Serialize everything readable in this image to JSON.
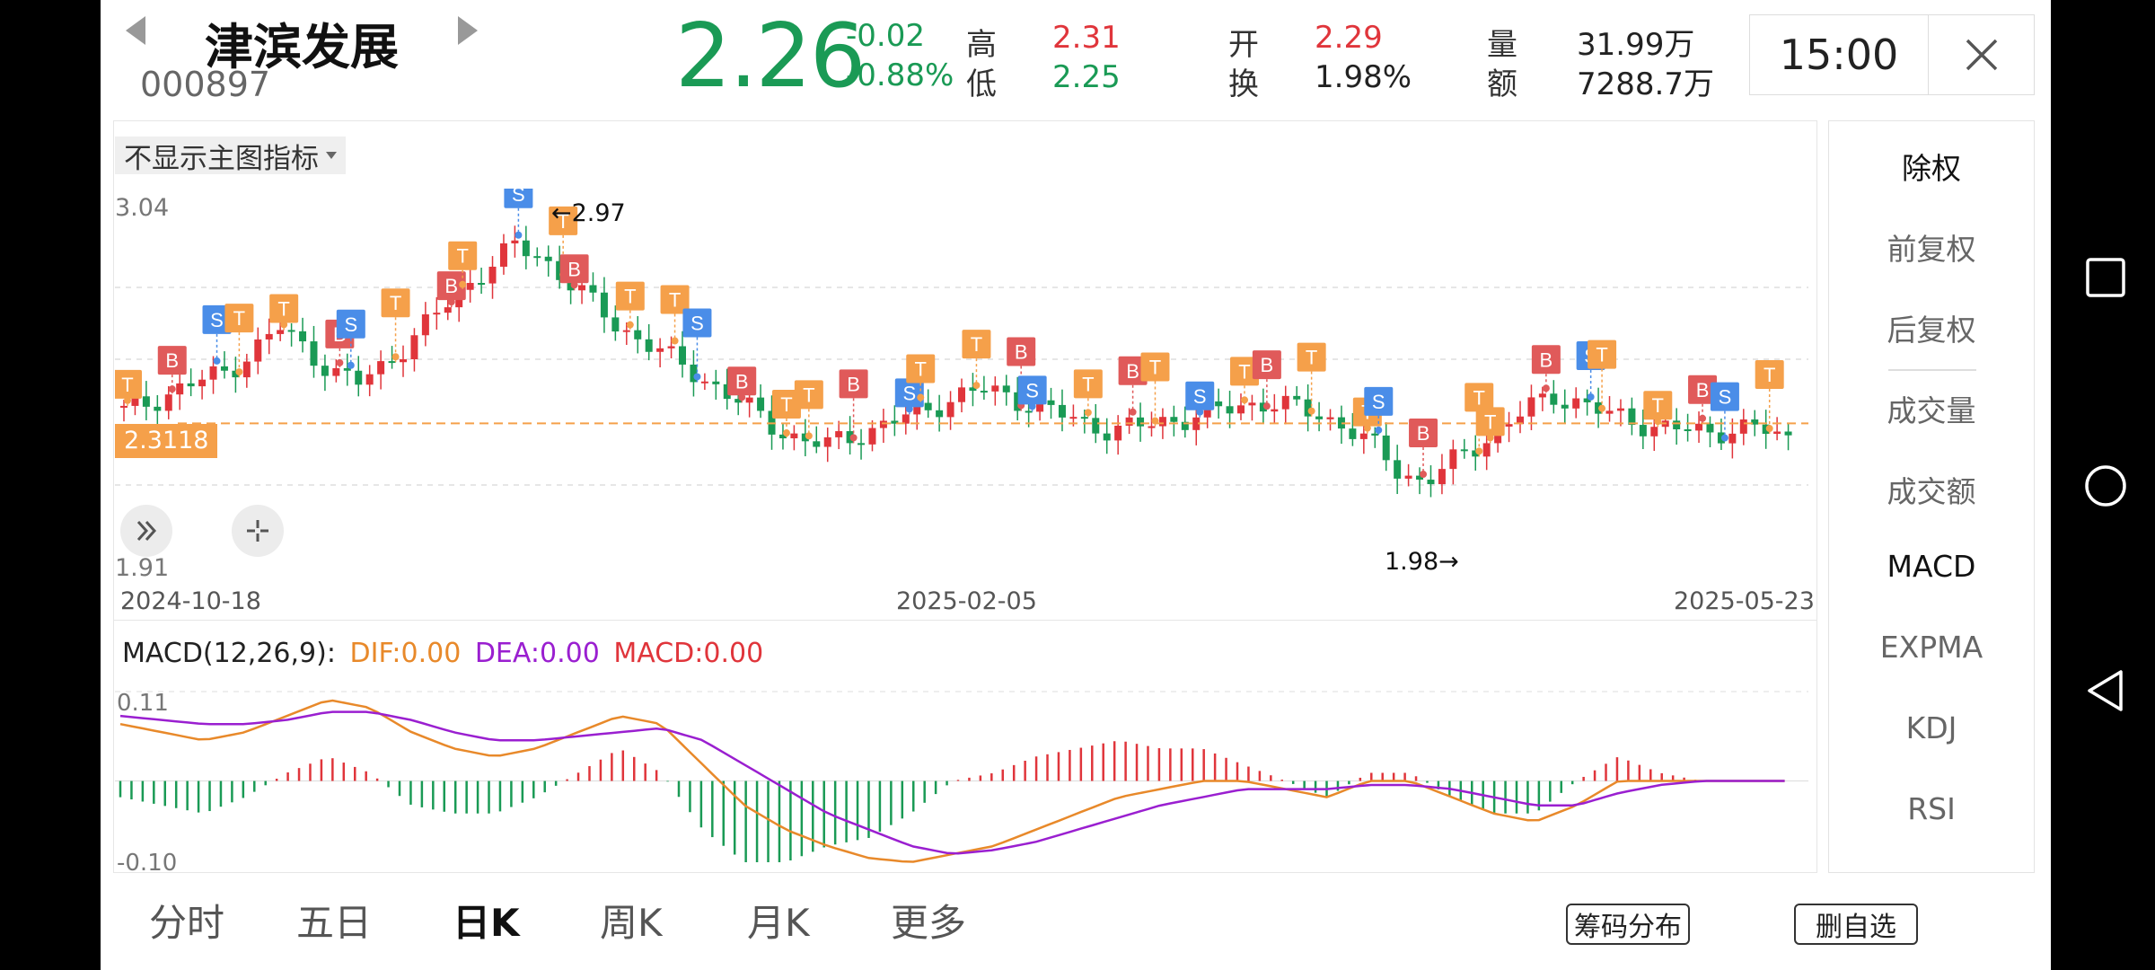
{
  "header": {
    "name": "津滨发展",
    "code": "000897",
    "price": "2.26",
    "change": "-0.02",
    "change_pct": "-0.88%",
    "high_label": "高",
    "high": "2.31",
    "low_label": "低",
    "low": "2.25",
    "open_label": "开",
    "open": "2.29",
    "turnover_label": "换",
    "turnover": "1.98%",
    "volume_label": "量",
    "volume": "31.99万",
    "amount_label": "额",
    "amount": "7288.7万",
    "time": "15:00"
  },
  "chart": {
    "indicator_dropdown": "不显示主图指标",
    "y_max": "3.04",
    "y_min": "1.91",
    "high_marker": "←2.97",
    "low_marker": "1.98→",
    "current_line_label": "2.3118",
    "dates": [
      "2024-10-18",
      "2025-02-05",
      "2025-05-23"
    ]
  },
  "macd": {
    "title": "MACD(12,26,9):",
    "dif": "DIF:0.00",
    "dea": "DEA:0.00",
    "macd": "MACD:0.00",
    "y_max": "0.11",
    "y_min": "-0.10"
  },
  "side_menu": [
    "除权",
    "前复权",
    "后复权",
    "成交量",
    "成交额",
    "MACD",
    "EXPMA",
    "KDJ",
    "RSI"
  ],
  "tabs": [
    "分时",
    "五日",
    "日K",
    "周K",
    "月K",
    "更多"
  ],
  "buttons": {
    "chips": "筹码分布",
    "remove_watch": "删自选"
  },
  "colors": {
    "up": "#e0353b",
    "down": "#1a9a55",
    "buy_badge": "#e05a5a",
    "sell_badge": "#4a8de8",
    "t_badge": "#f5a04a",
    "dif": "#e8892a",
    "dea": "#9a1fd0"
  },
  "chart_data": {
    "type": "candlestick",
    "x_range": [
      "2024-10-18",
      "2025-05-23"
    ],
    "ylim": [
      1.91,
      3.04
    ],
    "annotations": [
      {
        "label": "2.97",
        "kind": "high"
      },
      {
        "label": "1.98",
        "kind": "low"
      }
    ],
    "close_trend": [
      2.35,
      2.38,
      2.42,
      2.45,
      2.48,
      2.55,
      2.62,
      2.55,
      2.48,
      2.44,
      2.5,
      2.58,
      2.66,
      2.74,
      2.82,
      2.88,
      2.85,
      2.78,
      2.7,
      2.62,
      2.58,
      2.52,
      2.47,
      2.42,
      2.36,
      2.3,
      2.26,
      2.24,
      2.27,
      2.3,
      2.33,
      2.36,
      2.4,
      2.42,
      2.4,
      2.37,
      2.34,
      2.31,
      2.29,
      2.3,
      2.32,
      2.33,
      2.35,
      2.37,
      2.38,
      2.36,
      2.34,
      2.3,
      2.24,
      2.16,
      2.12,
      2.18,
      2.24,
      2.3,
      2.36,
      2.4,
      2.38,
      2.34,
      2.32,
      2.3,
      2.29,
      2.28,
      2.3,
      2.29,
      2.26
    ],
    "macd_dif_trend": [
      0.07,
      0.06,
      0.05,
      0.06,
      0.08,
      0.1,
      0.09,
      0.06,
      0.04,
      0.03,
      0.04,
      0.06,
      0.08,
      0.07,
      0.02,
      -0.03,
      -0.06,
      -0.08,
      -0.095,
      -0.1,
      -0.09,
      -0.08,
      -0.06,
      -0.04,
      -0.02,
      -0.01,
      0.0,
      0.0,
      -0.01,
      -0.02,
      0.0,
      0.0,
      -0.02,
      -0.04,
      -0.05,
      -0.03,
      0.0,
      0.0,
      0.0,
      0.0,
      0.0
    ],
    "macd_dea_trend": [
      0.08,
      0.075,
      0.07,
      0.07,
      0.075,
      0.085,
      0.085,
      0.075,
      0.06,
      0.05,
      0.05,
      0.055,
      0.06,
      0.065,
      0.05,
      0.02,
      -0.01,
      -0.04,
      -0.06,
      -0.08,
      -0.09,
      -0.085,
      -0.075,
      -0.06,
      -0.045,
      -0.03,
      -0.02,
      -0.01,
      -0.01,
      -0.01,
      -0.005,
      -0.005,
      -0.01,
      -0.02,
      -0.03,
      -0.03,
      -0.015,
      -0.005,
      0.0,
      0.0,
      0.0
    ]
  }
}
